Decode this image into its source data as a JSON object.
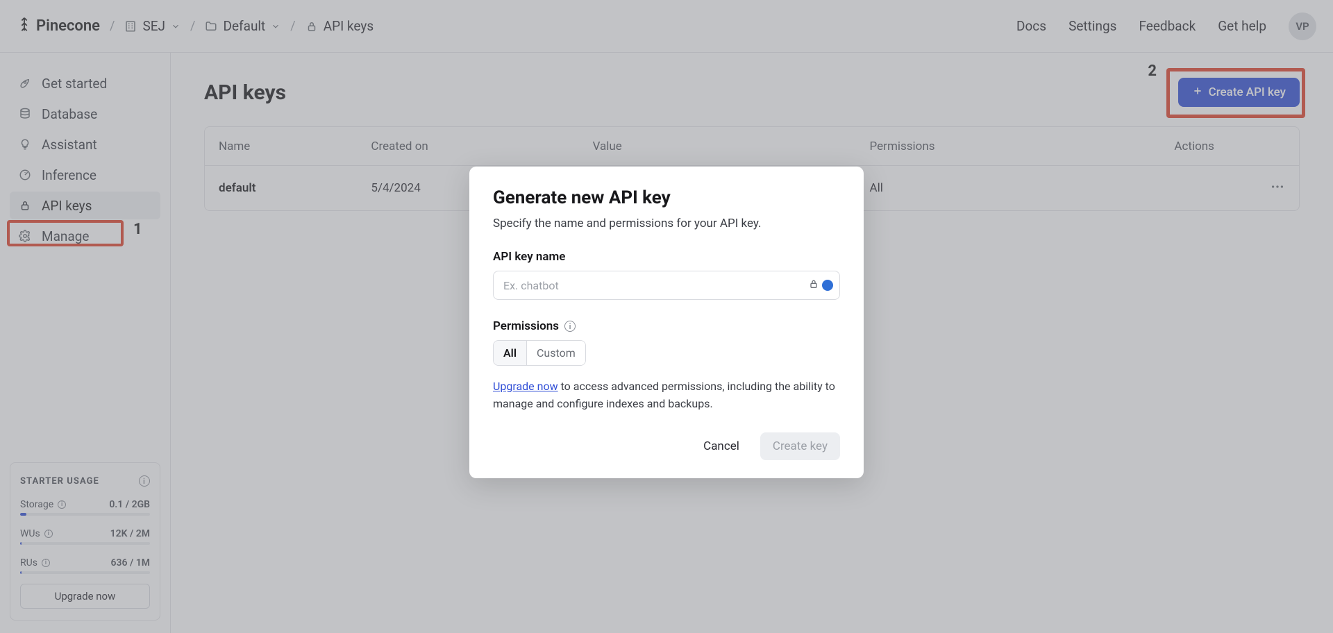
{
  "brand": "Pinecone",
  "breadcrumb": {
    "org": "SEJ",
    "project": "Default",
    "page": "API keys"
  },
  "topnav": {
    "docs": "Docs",
    "settings": "Settings",
    "feedback": "Feedback",
    "help": "Get help",
    "avatar": "VP"
  },
  "sidebar": {
    "items": [
      {
        "label": "Get started"
      },
      {
        "label": "Database"
      },
      {
        "label": "Assistant"
      },
      {
        "label": "Inference"
      },
      {
        "label": "API keys"
      },
      {
        "label": "Manage"
      }
    ]
  },
  "usage": {
    "title": "STARTER USAGE",
    "storage": {
      "label": "Storage",
      "value": "0.1 / 2GB",
      "pct": 5
    },
    "wus": {
      "label": "WUs",
      "value": "12K / 2M",
      "pct": 1
    },
    "rus": {
      "label": "RUs",
      "value": "636 / 1M",
      "pct": 1
    },
    "upgrade": "Upgrade now"
  },
  "page": {
    "title": "API keys",
    "create": "Create API key",
    "table": {
      "headers": [
        "Name",
        "Created on",
        "Value",
        "Permissions",
        "Actions"
      ],
      "rows": [
        {
          "name": "default",
          "created": "5/4/2024",
          "value": "",
          "permissions": "All"
        }
      ]
    }
  },
  "annotations": {
    "num1": "1",
    "num2": "2"
  },
  "modal": {
    "title": "Generate new API key",
    "subtitle": "Specify the name and permissions for your API key.",
    "name_label": "API key name",
    "name_placeholder": "Ex. chatbot",
    "perm_label": "Permissions",
    "perm_all": "All",
    "perm_custom": "Custom",
    "upgrade_link": "Upgrade now",
    "upgrade_text": " to access advanced permissions, including the ability to manage and configure indexes and backups.",
    "cancel": "Cancel",
    "create": "Create key"
  }
}
